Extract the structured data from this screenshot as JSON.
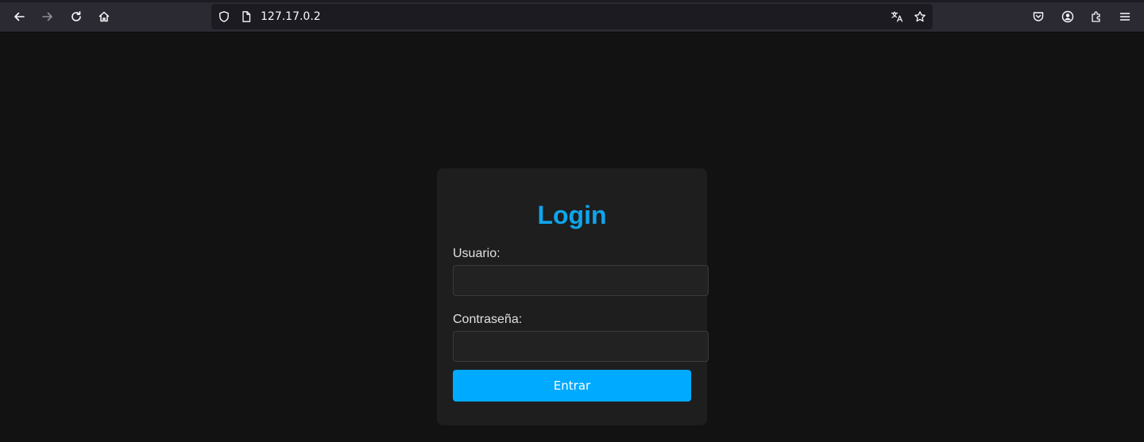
{
  "browser": {
    "url": "127.17.0.2",
    "icons": {
      "back": "back-arrow-icon",
      "forward": "forward-arrow-icon",
      "reload": "reload-icon",
      "home": "home-icon",
      "shield": "tracking-shield-icon",
      "page": "page-icon",
      "translate": "translate-icon",
      "bookmark": "star-icon",
      "pocket": "pocket-icon",
      "account": "account-icon",
      "extensions": "extensions-icon",
      "menu": "hamburger-menu-icon"
    },
    "colors": {
      "toolbar": "#2b2a33",
      "urlbar": "#1c1b22"
    }
  },
  "login": {
    "title": "Login",
    "username_label": "Usuario:",
    "username_value": "",
    "password_label": "Contraseña:",
    "password_value": "",
    "submit_label": "Entrar",
    "colors": {
      "accent": "#00aaff",
      "title": "#0ea5ee",
      "page_background": "#121212",
      "card_background": "#1e1e1e"
    }
  }
}
